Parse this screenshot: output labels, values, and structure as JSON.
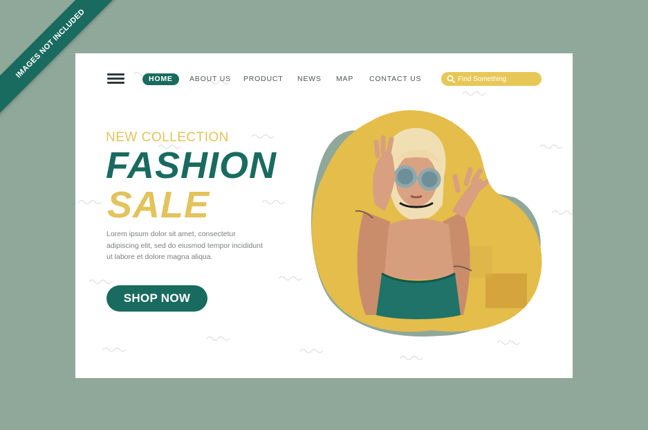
{
  "watermark": {
    "text": "IMAGES NOT INCLUDED"
  },
  "nav": {
    "items": [
      {
        "label": "HOME",
        "active": true
      },
      {
        "label": "ABOUT US",
        "active": false
      },
      {
        "label": "PRODUCT",
        "active": false
      },
      {
        "label": "NEWS",
        "active": false
      },
      {
        "label": "MAP",
        "active": false
      },
      {
        "label": "CONTACT US",
        "active": false
      }
    ]
  },
  "search": {
    "placeholder": "Find Something"
  },
  "hero": {
    "eyebrow": "NEW COLLECTION",
    "title_line1": "FASHION",
    "title_line2": "SALE",
    "description": [
      "Lorem ipsum dolor sit amet, consectetur",
      "adipiscing elit, sed do eiusmod tempor incididunt",
      "ut labore et dolore magna aliqua."
    ],
    "cta_label": "SHOP NOW"
  },
  "colors": {
    "background": "#8fa89a",
    "primary": "#1a6b5f",
    "accent": "#e2c35c",
    "page": "#ffffff"
  },
  "icons": {
    "search": "search-icon",
    "menu": "hamburger-menu-icon"
  }
}
